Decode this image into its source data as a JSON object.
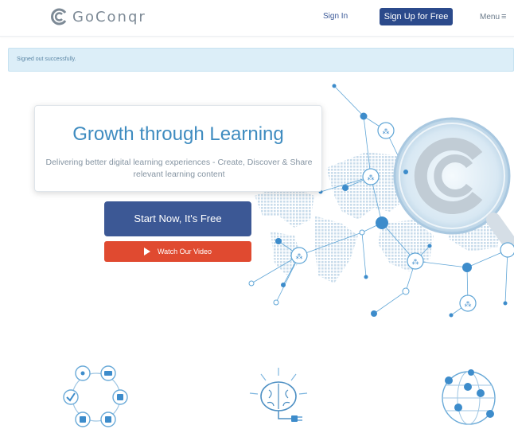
{
  "header": {
    "logo_text": "GoConqr",
    "signin_label": "Sign In",
    "signup_label": "Sign Up for Free",
    "menu_label": "Menu",
    "menu_icon": "≡"
  },
  "flash": {
    "message": "Signed out successfully."
  },
  "hero": {
    "title": "Growth through Learning",
    "subtitle": "Delivering better digital learning experiences - Create, Discover & Share relevant learning content",
    "start_label": "Start Now, It's Free",
    "video_label": "Watch Our Video"
  },
  "features": [
    {
      "icon": "tools-ring-icon"
    },
    {
      "icon": "brain-icon"
    },
    {
      "icon": "network-globe-icon"
    }
  ],
  "colors": {
    "brand_blue": "#3c5895",
    "signup_blue": "#2b4a8b",
    "video_red": "#e04a30",
    "accent_blue": "#3f8cc0",
    "flash_bg": "#dceef8"
  }
}
